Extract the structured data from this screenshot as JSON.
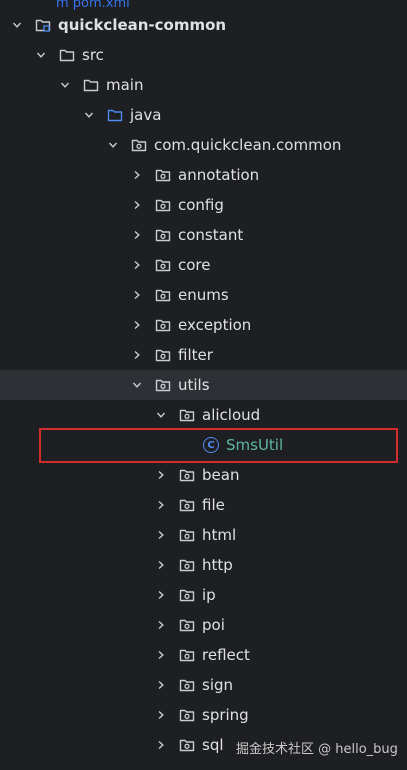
{
  "project_tree": {
    "top_partial_label": "m pom.xml",
    "items": [
      {
        "label": "quickclean-common",
        "kind": "module",
        "expanded": true,
        "depth": 0
      },
      {
        "label": "src",
        "kind": "folder",
        "expanded": true,
        "depth": 1
      },
      {
        "label": "main",
        "kind": "folder",
        "expanded": true,
        "depth": 2
      },
      {
        "label": "java",
        "kind": "source-folder",
        "expanded": true,
        "depth": 3
      },
      {
        "label": "com.quickclean.common",
        "kind": "package",
        "expanded": true,
        "depth": 4
      },
      {
        "label": "annotation",
        "kind": "package",
        "expanded": false,
        "depth": 5
      },
      {
        "label": "config",
        "kind": "package",
        "expanded": false,
        "depth": 5
      },
      {
        "label": "constant",
        "kind": "package",
        "expanded": false,
        "depth": 5
      },
      {
        "label": "core",
        "kind": "package",
        "expanded": false,
        "depth": 5
      },
      {
        "label": "enums",
        "kind": "package",
        "expanded": false,
        "depth": 5
      },
      {
        "label": "exception",
        "kind": "package",
        "expanded": false,
        "depth": 5
      },
      {
        "label": "filter",
        "kind": "package",
        "expanded": false,
        "depth": 5
      },
      {
        "label": "utils",
        "kind": "package",
        "expanded": true,
        "depth": 5,
        "selected": true
      },
      {
        "label": "alicloud",
        "kind": "package",
        "expanded": true,
        "depth": 6
      },
      {
        "label": "SmsUtil",
        "kind": "class",
        "depth": 7,
        "highlighted": true
      },
      {
        "label": "bean",
        "kind": "package",
        "expanded": false,
        "depth": 6
      },
      {
        "label": "file",
        "kind": "package",
        "expanded": false,
        "depth": 6
      },
      {
        "label": "html",
        "kind": "package",
        "expanded": false,
        "depth": 6
      },
      {
        "label": "http",
        "kind": "package",
        "expanded": false,
        "depth": 6
      },
      {
        "label": "ip",
        "kind": "package",
        "expanded": false,
        "depth": 6
      },
      {
        "label": "poi",
        "kind": "package",
        "expanded": false,
        "depth": 6
      },
      {
        "label": "reflect",
        "kind": "package",
        "expanded": false,
        "depth": 6
      },
      {
        "label": "sign",
        "kind": "package",
        "expanded": false,
        "depth": 6
      },
      {
        "label": "spring",
        "kind": "package",
        "expanded": false,
        "depth": 6
      },
      {
        "label": "sql",
        "kind": "package",
        "expanded": false,
        "depth": 6
      }
    ]
  },
  "watermark": "掘金技术社区 @ hello_bug",
  "colors": {
    "background": "#1e1f22",
    "selected_row": "#2e3035",
    "highlight_border": "#d22c2c",
    "class_label": "#5fb8a4",
    "source_folder_icon": "#4e8cf0"
  }
}
